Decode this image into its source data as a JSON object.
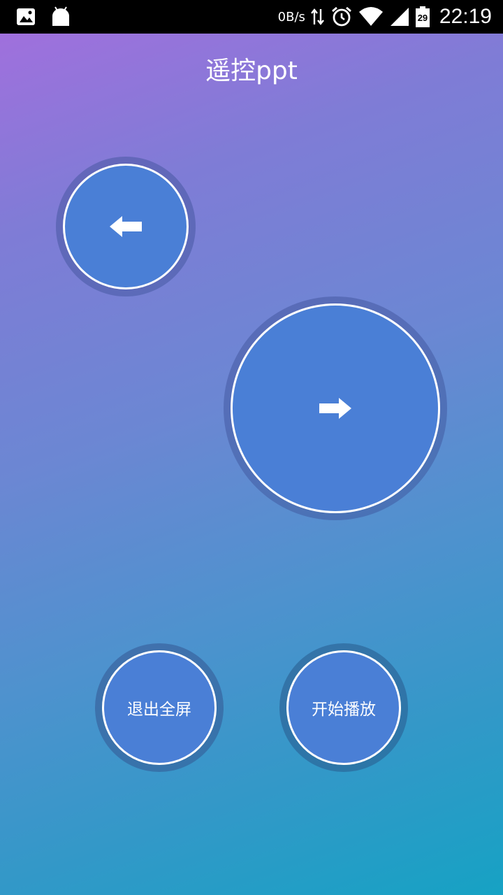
{
  "status_bar": {
    "net_speed": "0B/s",
    "time": "22:19",
    "battery_level": "29",
    "icons": [
      "image-icon",
      "android-icon",
      "data-transfer-icon",
      "alarm-icon",
      "wifi-icon",
      "signal-icon",
      "battery-icon"
    ]
  },
  "header": {
    "title": "遥控ppt"
  },
  "controls": {
    "prev_icon": "arrow-left-icon",
    "next_icon": "arrow-right-icon",
    "exit_fullscreen_label": "退出全屏",
    "start_play_label": "开始播放"
  },
  "colors": {
    "button_fill": "#4a7fd6",
    "button_border": "#ffffff",
    "gradient_top": "#a56ede",
    "gradient_bottom": "#16a2c4"
  }
}
